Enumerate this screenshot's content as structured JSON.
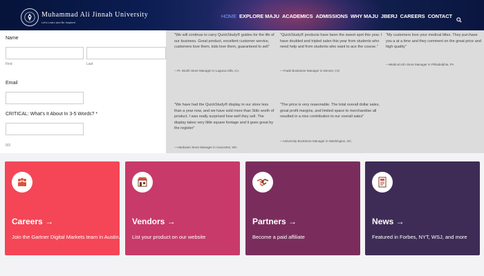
{
  "header": {
    "university_name": "Muhammad Ali Jinnah University",
    "tagline": "Let's Learn and Be Inspired",
    "nav": [
      "HOME",
      "EXPLORE MAJU",
      "ACADEMICS",
      "ADMISSIONS",
      "WHY MAJU",
      "JBERJ",
      "CAREERS",
      "CONTACT"
    ],
    "search_icon": "search-icon"
  },
  "form": {
    "name_label": "Name",
    "first_label": "First",
    "last_label": "Last",
    "first_value": "",
    "last_value": "",
    "email_label": "Email",
    "email_value": "",
    "critical_label": "CRITICAL: What's It About In 3-5 Words? *",
    "critical_value": "",
    "counter": "0/3"
  },
  "testimonials": [
    {
      "quote": "\"We will continue to carry QuickStudy® guides for the life of our business. Great product, excellent customer service, customers love them, kids love them, guaranteed to sell\"",
      "attribution": "—Ft. Worth Store Manager in Laguna Hills, CA"
    },
    {
      "quote": "\"QuickStudy® products have been the sweet spot this year. I have doubled and tripled sales this year from students who need help and from students who want to ace the course.\"",
      "attribution": "—Trade Bookstore Manager in Denver, CO"
    },
    {
      "quote": "\"My customers love your medical titles. They purchase you a at a time and they comment on the great price and high quality\"",
      "attribution": "—Medical Info Store Manager in Philadelphia, PA"
    },
    {
      "quote": "\"We have had the QuickStudy® display in our store less than a year now, and we have sold more than Stilo worth of product. I was really surprised how well they sell. The display takes very little square footage and it goes great by the register\"",
      "attribution": "—Hardware Store Manager in Anacortes, WA"
    },
    {
      "quote": "\"The price is very reasonable. The total overall dollar sales, great profit margins, and limited space to merchandise all resulted in a nice contribution to our overall sales\"",
      "attribution": "—University Bookstore Manager in Washington, DC"
    }
  ],
  "cards": [
    {
      "title": "Careers →",
      "desc": "Join the Gartner Digital Markets team in Austin.",
      "color": "#f44657",
      "icon": "team-icon"
    },
    {
      "title": "Vendors →",
      "desc": "List your product on our website",
      "color": "#c83a6a",
      "icon": "storefront-icon"
    },
    {
      "title": "Partners →",
      "desc": "Become a paid affiliate",
      "color": "#7a2d5d",
      "icon": "handshake-icon"
    },
    {
      "title": "News →",
      "desc": "Featured in Forbes, NYT, WSJ, and more",
      "color": "#3e2c57",
      "icon": "newspaper-icon"
    }
  ]
}
